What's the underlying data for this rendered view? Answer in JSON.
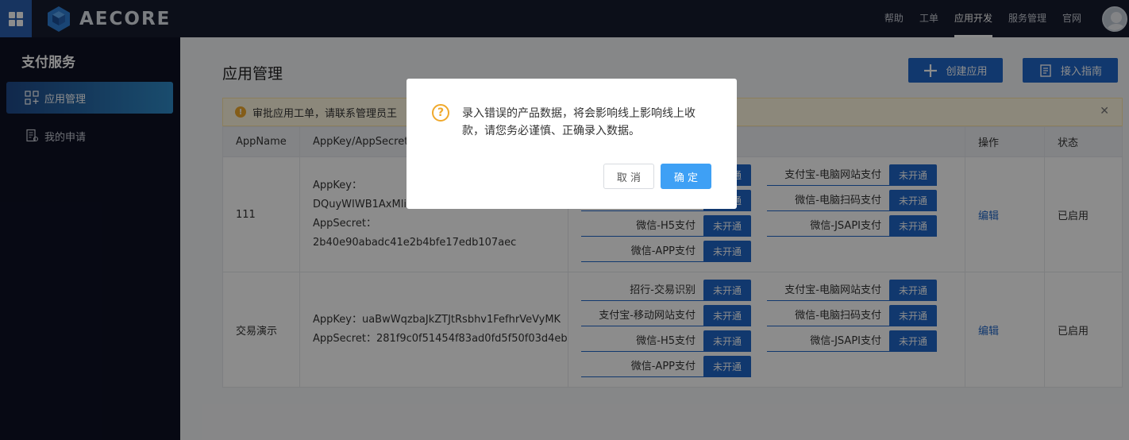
{
  "topbar": {
    "logo_text": "AECORE",
    "nav": [
      "帮助",
      "工单",
      "应用开发",
      "服务管理",
      "官网"
    ],
    "active_nav": "应用开发"
  },
  "sidebar": {
    "title": "支付服务",
    "items": [
      {
        "label": "应用管理",
        "icon": "apps-grid-icon",
        "active": true
      },
      {
        "label": "我的申请",
        "icon": "application-form-icon",
        "active": false
      }
    ]
  },
  "main": {
    "title": "应用管理",
    "create_button": "创建应用",
    "guide_button": "接入指南",
    "notice": "审批应用工单，请联系管理员王",
    "columns": [
      "AppName",
      "AppKey/AppSecret",
      "",
      "操作",
      "状态"
    ],
    "rows": [
      {
        "name": "111",
        "appkey_label": "AppKey：",
        "appkey": "DQuyWIWB1AxMliY",
        "appsecret_label": "AppSecret：",
        "appsecret": "2b40e90abadc41e2b4bfe17edb107aec",
        "products_left": [
          {
            "name": "",
            "status": "未开通"
          },
          {
            "name": "",
            "status": "未开通"
          },
          {
            "name": "微信-H5支付",
            "status": "未开通"
          },
          {
            "name": "微信-APP支付",
            "status": "未开通"
          }
        ],
        "products_right": [
          {
            "name": "支付宝-电脑网站支付",
            "status": "未开通"
          },
          {
            "name": "微信-电脑扫码支付",
            "status": "未开通"
          },
          {
            "name": "微信-JSAPI支付",
            "status": "未开通"
          }
        ],
        "action": "编辑",
        "state": "已启用"
      },
      {
        "name": "交易演示",
        "appkey_label": "AppKey：",
        "appkey": "uaBwWqzbaJkZTJtRsbhv1FefhrVeVyMK",
        "appsecret_label": "AppSecret：",
        "appsecret": "281f9c0f51454f83ad0fd5f50f03d4eb",
        "products_left": [
          {
            "name": "招行-交易识别",
            "status": "未开通"
          },
          {
            "name": "支付宝-移动网站支付",
            "status": "未开通"
          },
          {
            "name": "微信-H5支付",
            "status": "未开通"
          },
          {
            "name": "微信-APP支付",
            "status": "未开通"
          }
        ],
        "products_right": [
          {
            "name": "支付宝-电脑网站支付",
            "status": "未开通"
          },
          {
            "name": "微信-电脑扫码支付",
            "status": "未开通"
          },
          {
            "name": "微信-JSAPI支付",
            "status": "未开通"
          }
        ],
        "action": "编辑",
        "state": "已启用"
      }
    ]
  },
  "dialog": {
    "message": "录入错误的产品数据，将会影响线上影响线上收款，请您务必谨慎、正确录入数据。",
    "cancel": "取 消",
    "ok": "确 定"
  },
  "colors": {
    "primary": "#1f66c9",
    "ok_button": "#3ea0f5",
    "warning": "#f0a92c",
    "topbar": "#171c2f",
    "sidebar": "#0d1124"
  }
}
